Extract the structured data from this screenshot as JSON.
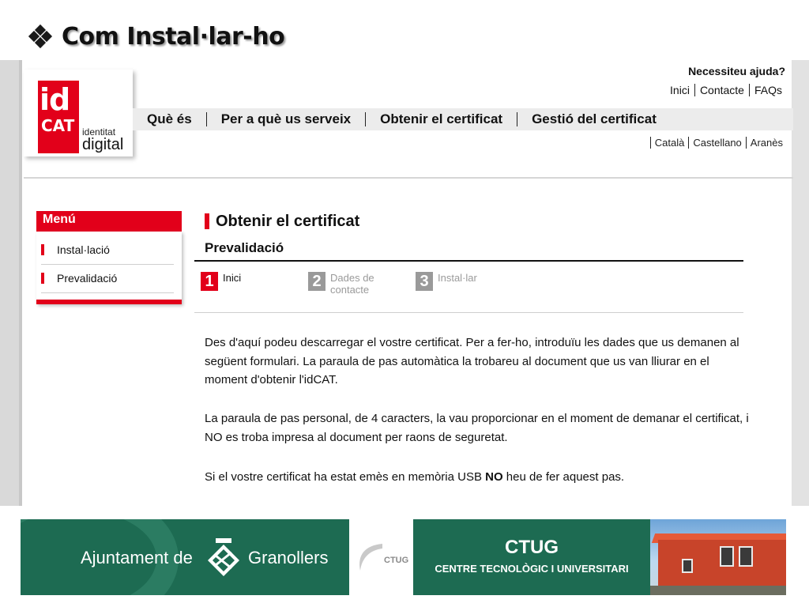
{
  "slide": {
    "title": "Com Instal·lar-ho"
  },
  "site": {
    "logo": {
      "id": "id",
      "cat": "CAT",
      "line1": "identitat",
      "line2": "digital"
    },
    "help": "Necessiteu ajuda?",
    "toplinks": [
      "Inici",
      "Contacte",
      "FAQs"
    ],
    "nav": [
      "Què és",
      "Per a què us serveix",
      "Obtenir el certificat",
      "Gestió del certificat"
    ],
    "languages": [
      "Català",
      "Castellano",
      "Aranès"
    ],
    "menu": {
      "title": "Menú",
      "items": [
        "Instal·lació",
        "Prevalidació"
      ]
    },
    "main": {
      "title": "Obtenir el certificat",
      "subtitle": "Prevalidació",
      "steps": [
        {
          "num": "1",
          "label": "Inici"
        },
        {
          "num": "2",
          "label": "Dades de contacte"
        },
        {
          "num": "3",
          "label": "Instal·lar"
        }
      ],
      "p1": "Des d'aquí podeu descarregar el vostre certificat. Per a fer-ho, introduïu les dades que us demanen al següent formulari. La paraula de pas automàtica la trobareu al document que us van lliurar en el moment d'obtenir l'idCAT.",
      "p2": "La paraula de pas personal, de 4 caracters, la vau proporcionar en el moment de demanar el certificat, i NO es troba impresa al document per raons de seguretat.",
      "p3_before": "Si el vostre certificat ha estat emès en memòria USB ",
      "p3_bold": "NO",
      "p3_after": " heu de fer aquest pas."
    }
  },
  "footer": {
    "granollers": {
      "left": "Ajuntament de",
      "right": "Granollers"
    },
    "ctug_small": "CTUG",
    "ctug": {
      "title": "CTUG",
      "subtitle": "CENTRE TECNOLÒGIC I UNIVERSITARI"
    }
  },
  "colors": {
    "accent_red": "#e2001a",
    "green": "#1d6b52",
    "step_gray": "#9a9a9a"
  }
}
